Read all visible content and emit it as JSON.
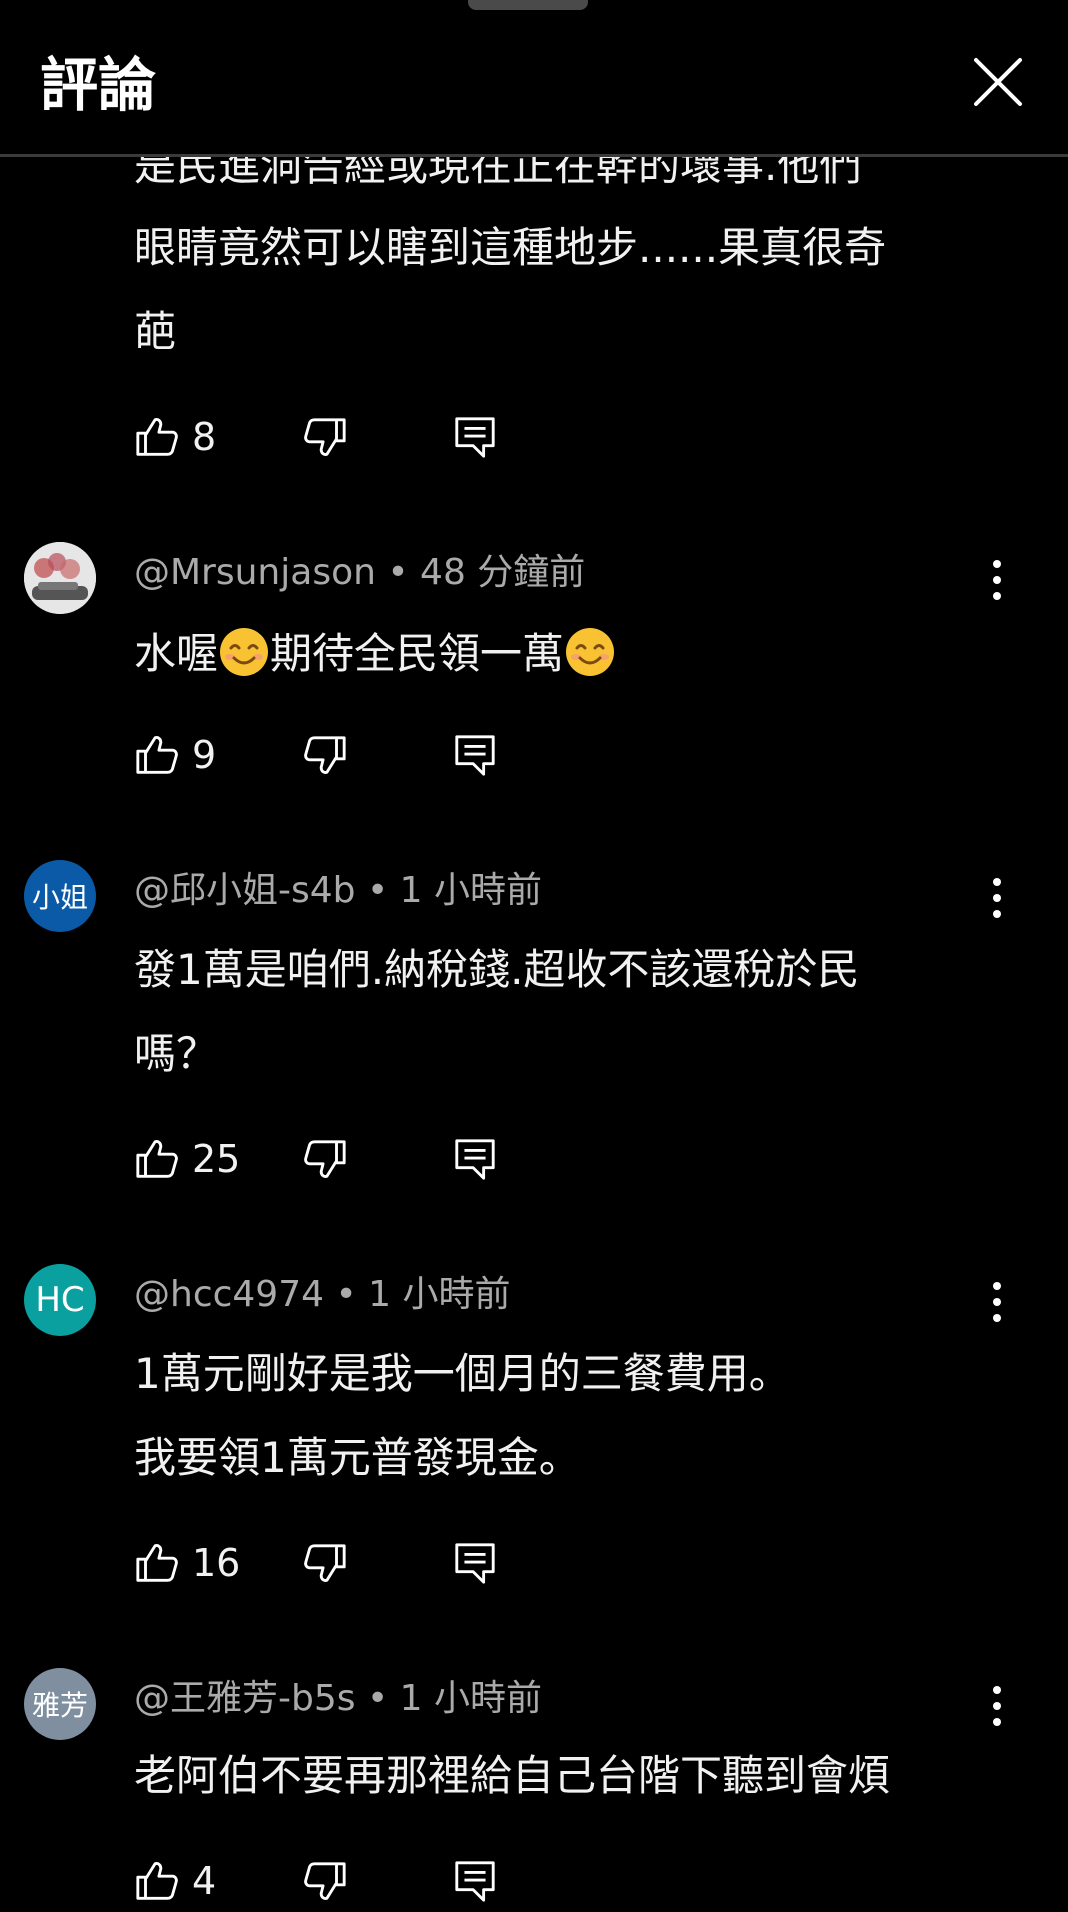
{
  "header": {
    "title": "評論"
  },
  "icons": {
    "close": "close-icon",
    "like": "thumbs-up-icon",
    "dislike": "thumbs-down-icon",
    "reply": "reply-icon",
    "more": "more-vert-icon",
    "emoji": "smiling-face-emoji"
  },
  "colors": {
    "background": "#000000",
    "meta_text": "#aaaaaa",
    "avatar_blue": "#0a5aa8",
    "avatar_teal": "#0aa0a0",
    "avatar_gray": "#7f8fa0"
  },
  "partial_comment": {
    "line1": "是民進洞告經或現在正在幹的壞事.他們",
    "line2": "眼睛竟然可以瞎到這種地步......果真很奇",
    "line3": "葩",
    "likes": "8"
  },
  "comments": [
    {
      "handle": "@Mrsunjason",
      "sep": " • ",
      "time": "48 分鐘前",
      "avatar_text": "",
      "text_a": "水喔",
      "text_b": "期待全民領一萬",
      "likes": "9"
    },
    {
      "handle": "@邱小姐-s4b",
      "sep": " • ",
      "time": "1 小時前",
      "avatar_text": "小姐",
      "line1": "發1萬是咱們.納稅錢.超收不該還稅於民",
      "line2": "嗎？",
      "likes": "25"
    },
    {
      "handle": "@hcc4974",
      "sep": " • ",
      "time": "1 小時前",
      "avatar_text": "HC",
      "line1": "1萬元剛好是我一個月的三餐費用。",
      "line2": "我要領1萬元普發現金。",
      "likes": "16"
    },
    {
      "handle": "@王雅芳-b5s",
      "sep": " • ",
      "time": "1 小時前",
      "avatar_text": "雅芳",
      "line1": "老阿伯不要再那裡給自己台階下聽到會煩",
      "likes": "4"
    }
  ]
}
